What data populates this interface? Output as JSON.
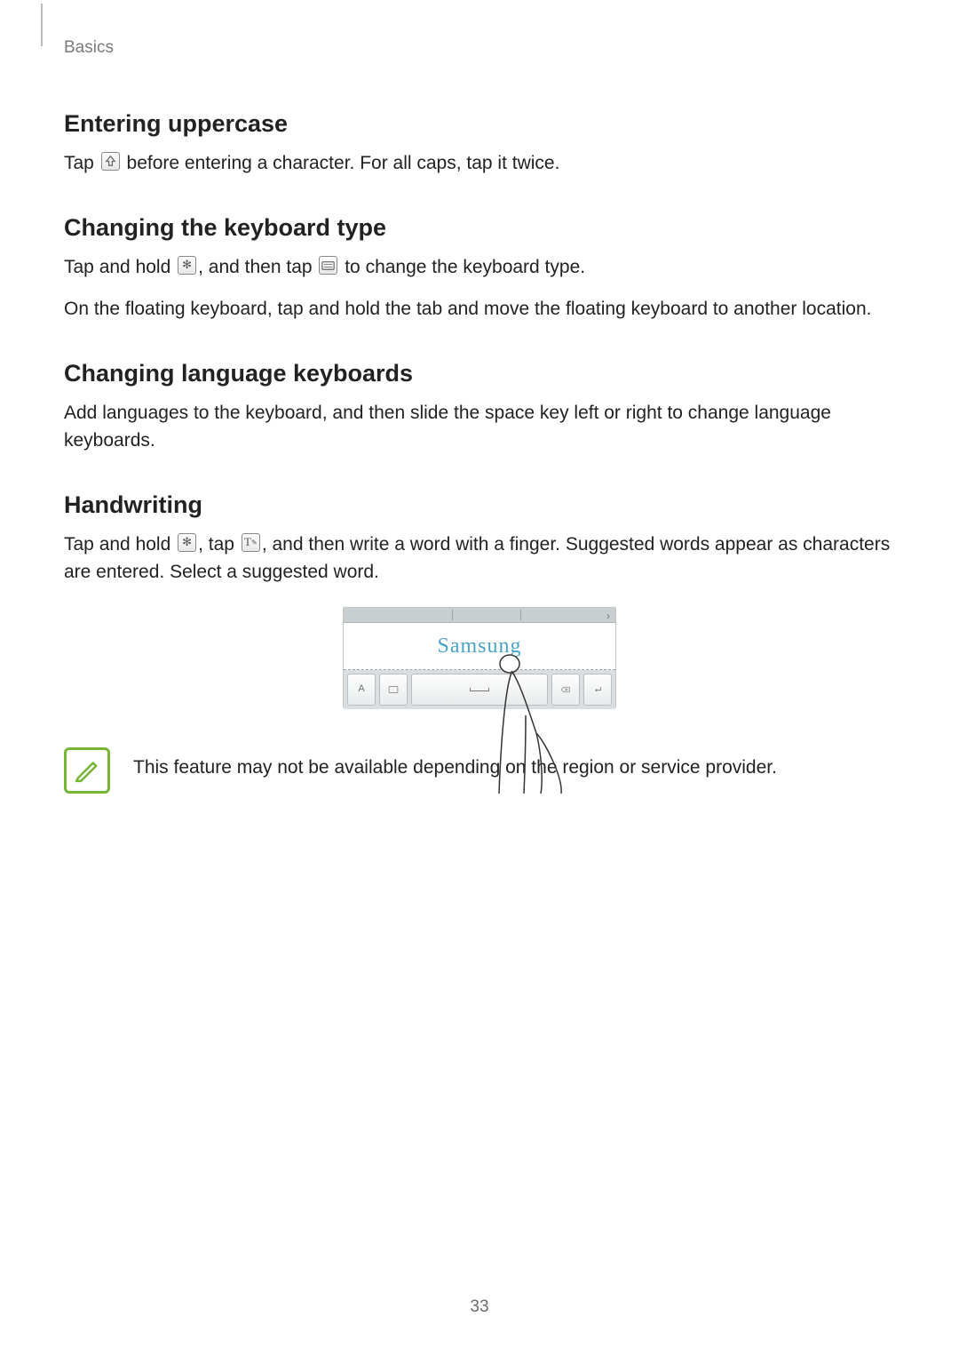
{
  "breadcrumb": "Basics",
  "page_number": "33",
  "sections": {
    "uppercase": {
      "heading": "Entering uppercase",
      "text_before": "Tap ",
      "text_after": " before entering a character. For all caps, tap it twice."
    },
    "kbtype": {
      "heading": "Changing the keyboard type",
      "line1_a": "Tap and hold ",
      "line1_b": ", and then tap ",
      "line1_c": " to change the keyboard type.",
      "line2": "On the floating keyboard, tap and hold the tab and move the floating keyboard to another location."
    },
    "lang": {
      "heading": "Changing language keyboards",
      "text": "Add languages to the keyboard, and then slide the space key left or right to change language keyboards."
    },
    "hand": {
      "heading": "Handwriting",
      "line_a": "Tap and hold ",
      "line_b": ", tap ",
      "line_c": ", and then write a word with a finger. Suggested words appear as characters are entered. Select a suggested word."
    }
  },
  "figure": {
    "handwritten_word": "Samsung"
  },
  "note": "This feature may not be available depending on the region or service provider."
}
